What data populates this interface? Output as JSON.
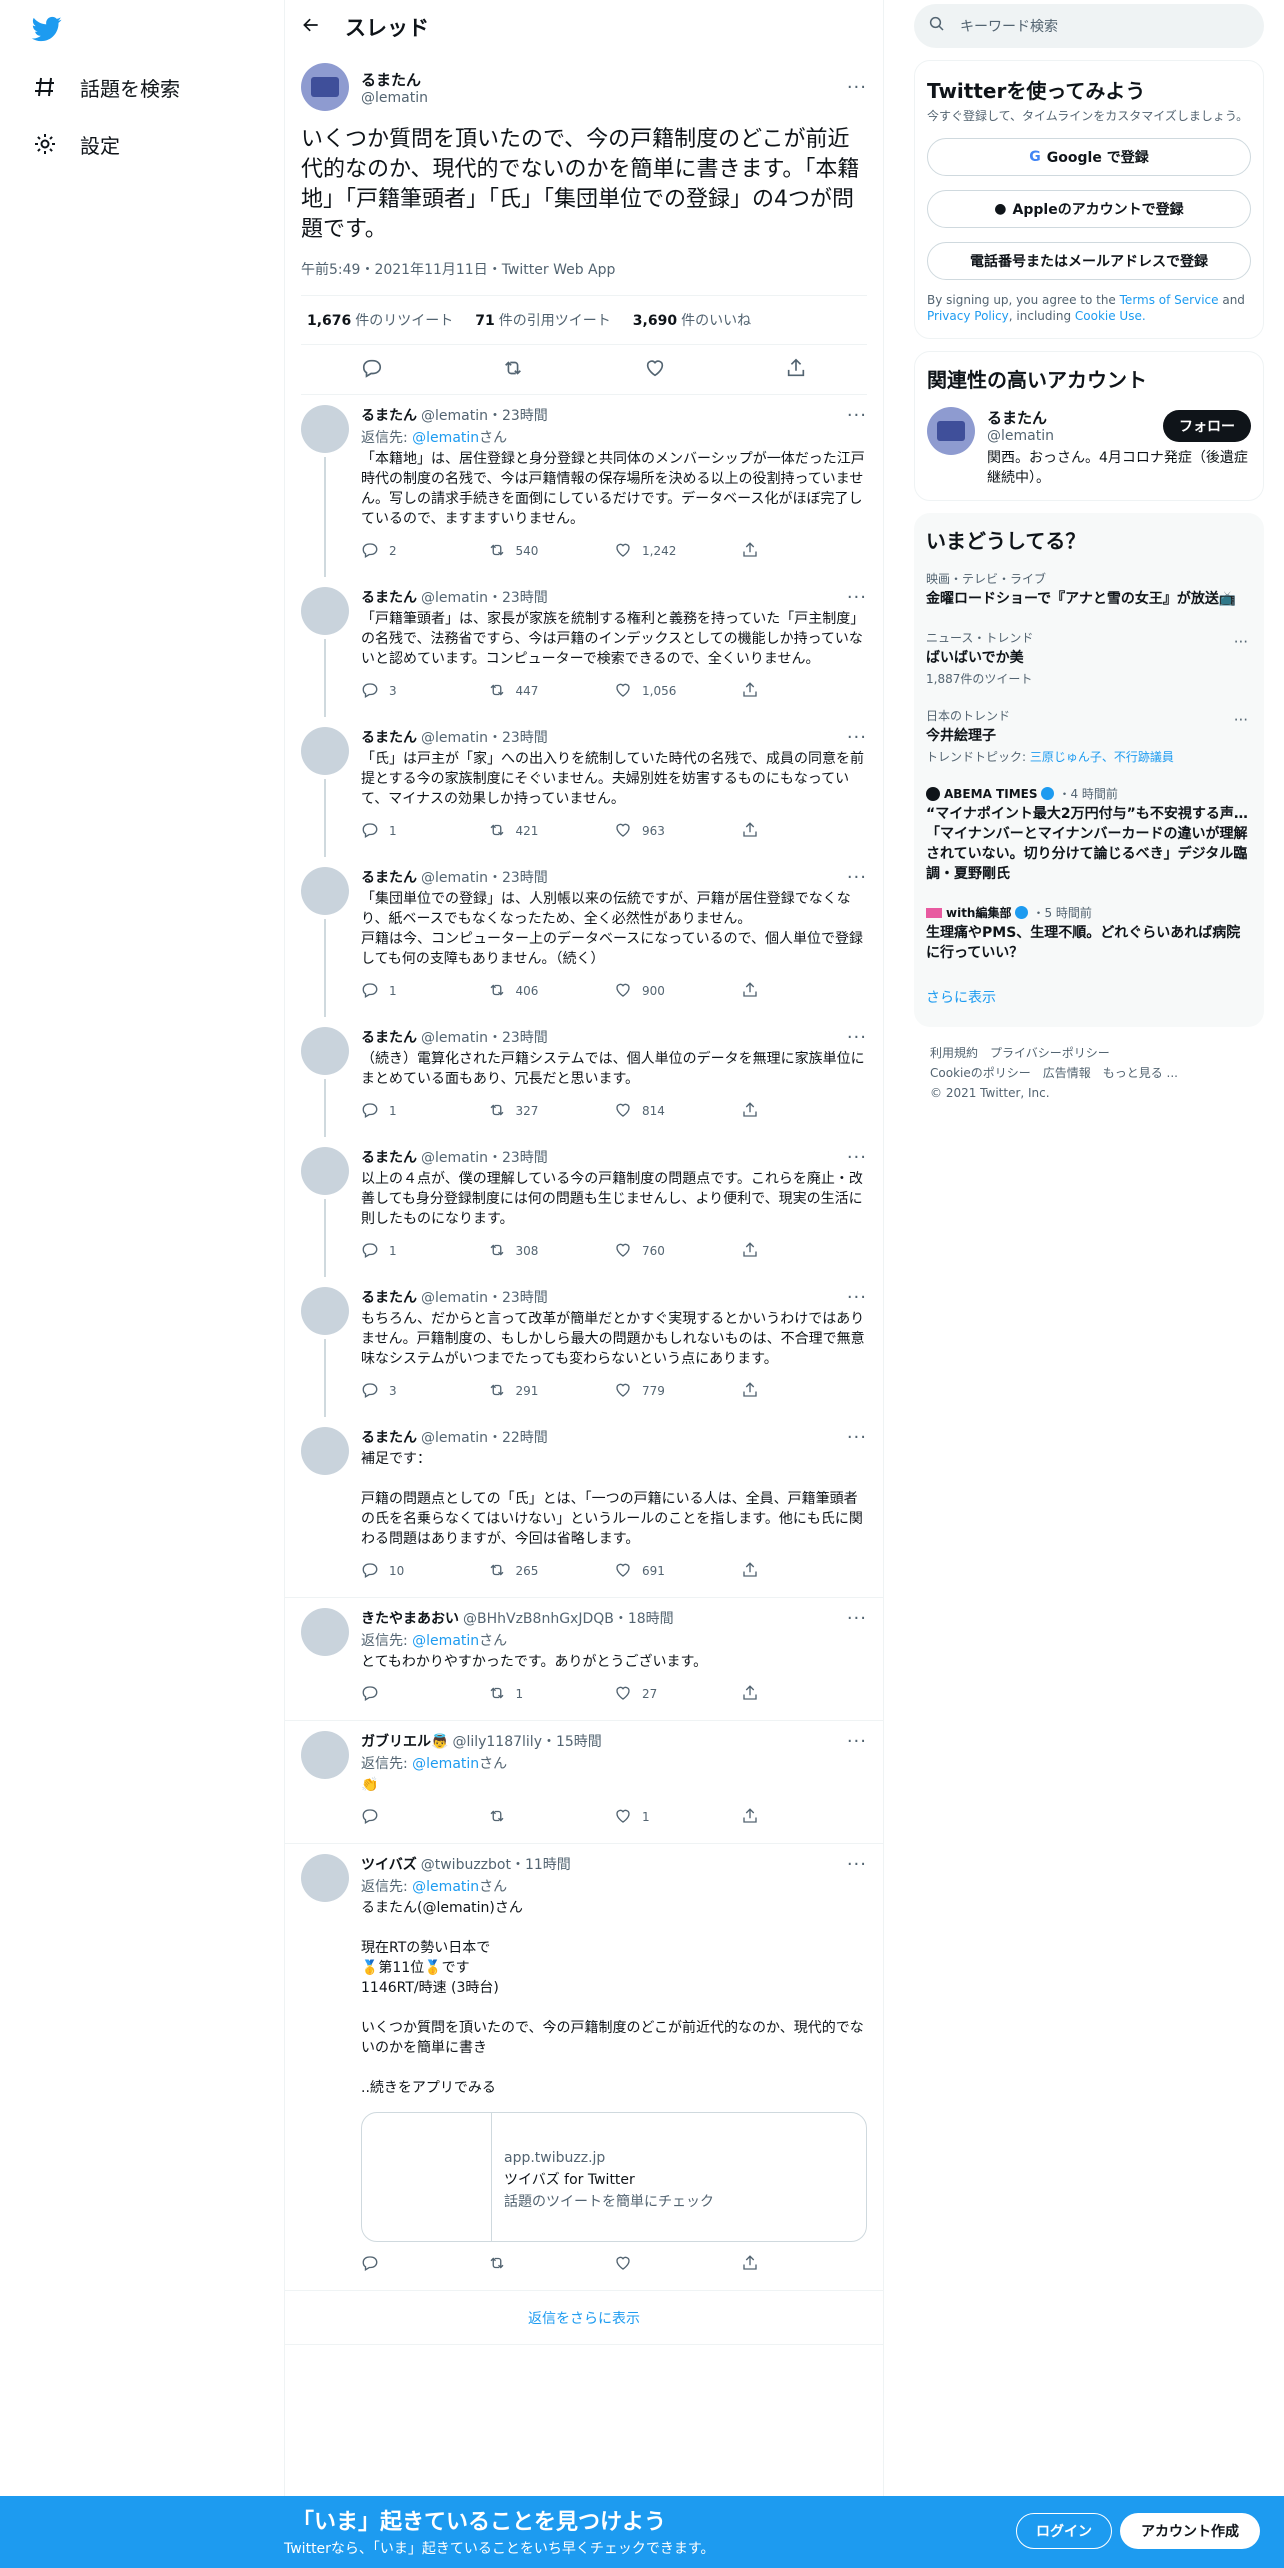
{
  "nav": {
    "explore": "話題を検索",
    "settings": "設定"
  },
  "header": {
    "title": "スレッド"
  },
  "main_tweet": {
    "name": "るまたん",
    "handle": "@lematin",
    "text": "いくつか質問を頂いたので、今の戸籍制度のどこが前近代的なのか、現代的でないのかを簡単に書きます。「本籍地」「戸籍筆頭者」「氏」「集団単位での登録」の4つが問題です。",
    "time": "午前5:49・2021年11月11日・Twitter Web App",
    "retweets": "1,676",
    "retweets_label": "件のリツイート",
    "quotes": "71",
    "quotes_label": "件の引用ツイート",
    "likes": "3,690",
    "likes_label": "件のいいね"
  },
  "replies": [
    {
      "name": "るまたん",
      "handle": "@lematin・23時間",
      "replyto_prefix": "返信先: ",
      "replyto": "@lematin",
      "replyto_suffix": "さん",
      "text": "「本籍地」は、居住登録と身分登録と共同体のメンバーシップが一体だった江戸時代の制度の名残で、今は戸籍情報の保存場所を決める以上の役割持っていません。写しの請求手続きを面倒にしているだけです。データベース化がほぼ完了しているので、ますますいりません。",
      "reply": "2",
      "retweet": "540",
      "like": "1,242"
    },
    {
      "name": "るまたん",
      "handle": "@lematin・23時間",
      "text": "「戸籍筆頭者」は、家長が家族を統制する権利と義務を持っていた「戸主制度」の名残で、法務省ですら、今は戸籍のインデックスとしての機能しか持っていないと認めています。コンピューターで検索できるので、全くいりません。",
      "reply": "3",
      "retweet": "447",
      "like": "1,056"
    },
    {
      "name": "るまたん",
      "handle": "@lematin・23時間",
      "text": "「氏」は戸主が「家」への出入りを統制していた時代の名残で、成員の同意を前提とする今の家族制度にそぐいません。夫婦別姓を妨害するものにもなっていて、マイナスの効果しか持っていません。",
      "reply": "1",
      "retweet": "421",
      "like": "963"
    },
    {
      "name": "るまたん",
      "handle": "@lematin・23時間",
      "text": "「集団単位での登録」は、人別帳以来の伝統ですが、戸籍が居住登録でなくなり、紙ベースでもなくなったため、全く必然性がありません。\n戸籍は今、コンピューター上のデータベースになっているので、個人単位で登録しても何の支障もありません。（続く）",
      "reply": "1",
      "retweet": "406",
      "like": "900"
    },
    {
      "name": "るまたん",
      "handle": "@lematin・23時間",
      "text": "（続き）電算化された戸籍システムでは、個人単位のデータを無理に家族単位にまとめている面もあり、冗長だと思います。",
      "reply": "1",
      "retweet": "327",
      "like": "814"
    },
    {
      "name": "るまたん",
      "handle": "@lematin・23時間",
      "text": "以上の４点が、僕の理解している今の戸籍制度の問題点です。これらを廃止・改善しても身分登録制度には何の問題も生じませんし、より便利で、現実の生活に則したものになります。",
      "reply": "1",
      "retweet": "308",
      "like": "760"
    },
    {
      "name": "るまたん",
      "handle": "@lematin・23時間",
      "text": "もちろん、だからと言って改革が簡単だとかすぐ実現するとかいうわけではありません。戸籍制度の、もしかしら最大の問題かもしれないものは、不合理で無意味なシステムがいつまでたっても変わらないという点にあります。",
      "reply": "3",
      "retweet": "291",
      "like": "779"
    },
    {
      "name": "るまたん",
      "handle": "@lematin・22時間",
      "text": "補足です：\n\n戸籍の問題点としての「氏」とは、「一つの戸籍にいる人は、全員、戸籍筆頭者の氏を名乗らなくてはいけない」というルールのことを指します。他にも氏に関わる問題はありますが、今回は省略します。",
      "reply": "10",
      "retweet": "265",
      "like": "691"
    },
    {
      "name": "きたやまあおい",
      "handle": "@BHhVzB8nhGxJDQB・18時間",
      "replyto_prefix": "返信先: ",
      "replyto": "@lematin",
      "replyto_suffix": "さん",
      "text": "とてもわかりやすかったです。ありがとうございます。",
      "reply": "",
      "retweet": "1",
      "like": "27"
    },
    {
      "name": "ガブリエル👼",
      "handle": "@lily1187lily・15時間",
      "replyto_prefix": "返信先: ",
      "replyto": "@lematin",
      "replyto_suffix": "さん",
      "text": "👏",
      "reply": "",
      "retweet": "",
      "like": "1"
    },
    {
      "name": "ツイバズ",
      "handle": "@twibuzzbot・11時間",
      "replyto_prefix": "返信先: ",
      "replyto": "@lematin",
      "replyto_suffix": "さん",
      "text": "るまたん(@lematin)さん\n\n現在RTの勢い日本で\n🥇第11位🥇です\n1146RT/時速 (3時台)\n\nいくつか質問を頂いたので、今の戸籍制度のどこが前近代的なのか、現代的でないのかを簡単に書き\n\n..続きをアプリでみる",
      "card_domain": "app.twibuzz.jp",
      "card_title": "ツイバズ for Twitter",
      "card_desc": "話題のツイートを簡単にチェック",
      "reply": "",
      "retweet": "",
      "like": ""
    }
  ],
  "show_more_replies": "返信をさらに表示",
  "search": {
    "placeholder": "キーワード検索"
  },
  "signup": {
    "title": "Twitterを使ってみよう",
    "sub": "今すぐ登録して、タイムラインをカスタマイズしましょう。",
    "google": "Google で登録",
    "apple": "Appleのアカウントで登録",
    "phone": "電話番号またはメールアドレスで登録",
    "terms_prefix": "By signing up, you agree to the ",
    "terms_link": "Terms of Service",
    "terms_and": " and ",
    "privacy_link": "Privacy Policy",
    "terms_including": ", including ",
    "cookie_link": "Cookie Use."
  },
  "related": {
    "title": "関連性の高いアカウント",
    "name": "るまたん",
    "handle": "@lematin",
    "follow": "フォロー",
    "bio": "関西。おっさん。4月コロナ発症（後遺症継続中）。"
  },
  "trends": {
    "title": "いまどうしてる？",
    "items": [
      {
        "meta": "映画・テレビ・ライブ",
        "name": "金曜ロードショーで『アナと雪の女王』が放送📺",
        "count": ""
      },
      {
        "meta": "ニュース・トレンド",
        "name": "ばいばいでか美",
        "count": "1,887件のツイート"
      },
      {
        "meta": "日本のトレンド",
        "name": "今井絵理子",
        "count_prefix": "トレンドトピック: ",
        "count_links": "三原じゅん子、不行跡議員"
      }
    ],
    "news": [
      {
        "source": "ABEMA TIMES",
        "time": "・4 時間前",
        "title": "“マイナポイント最大2万円付与”も不安視する声…「マイナンバーとマイナンバーカードの違いが理解されていない。切り分けて論じるべき」デジタル臨調・夏野剛氏"
      },
      {
        "source": "with編集部",
        "time": "・5 時間前",
        "title": "生理痛やPMS、生理不順。どれぐらいあれば病院に行っていい？"
      }
    ],
    "show_more": "さらに表示"
  },
  "footer": {
    "line1": "利用規約　プライバシーポリシー",
    "line2": "Cookieのポリシー　広告情報　もっと見る ...",
    "line3": "© 2021 Twitter, Inc."
  },
  "banner": {
    "title": "「いま」起きていることを見つけよう",
    "sub": "Twitterなら、「いま」起きていることをいち早くチェックできます。",
    "login": "ログイン",
    "signup": "アカウント作成"
  },
  "colors": {
    "accent": "#1d9bf0",
    "text": "#0f1419",
    "muted": "#536471"
  }
}
